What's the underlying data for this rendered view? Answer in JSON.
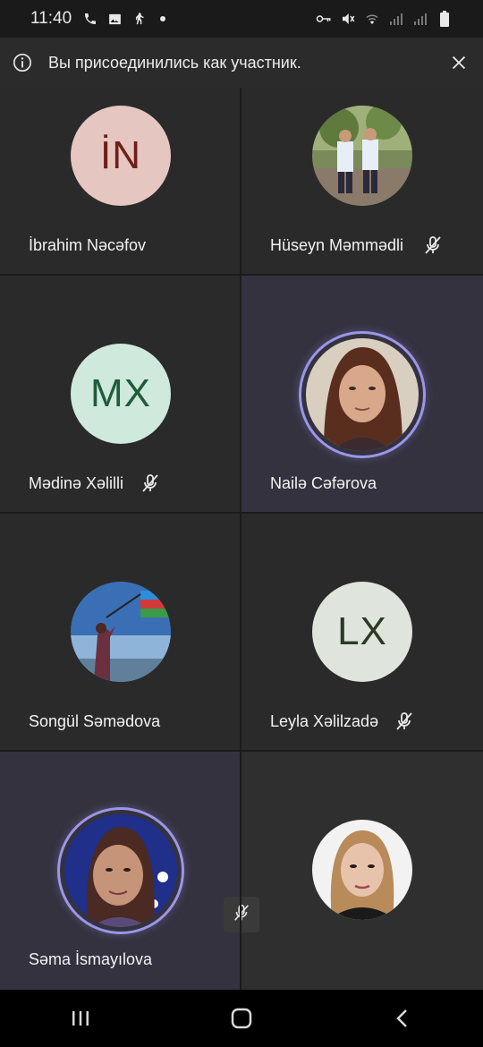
{
  "status_bar": {
    "time": "11:40",
    "left_icons": [
      "phone-icon",
      "image-icon",
      "walking-icon",
      "dot-icon"
    ],
    "right_icons": [
      "key-icon",
      "mute-icon",
      "wifi-icon",
      "signal-icon",
      "signal-icon",
      "battery-icon"
    ]
  },
  "banner": {
    "message": "Вы присоединились как участник.",
    "icon": "info-icon",
    "close_icon": "close-icon"
  },
  "participants": [
    {
      "name": "İbrahim Nəcəfov",
      "initials": "İN",
      "avatar_bg": "#e6c6c0",
      "initials_color": "#6e1f1a",
      "muted": false,
      "speaking": false,
      "photo": false
    },
    {
      "name": "Hüseyn Məmmədli",
      "initials": "",
      "muted": true,
      "speaking": false,
      "photo": true
    },
    {
      "name": "Mədinə Xəlilli",
      "initials": "MX",
      "avatar_bg": "#cfe9dc",
      "initials_color": "#1f5c3a",
      "muted": true,
      "speaking": false,
      "photo": false
    },
    {
      "name": "Nailə Cəfərova",
      "initials": "",
      "muted": false,
      "speaking": true,
      "photo": true
    },
    {
      "name": "Songül Səmədova",
      "initials": "",
      "muted": false,
      "speaking": false,
      "photo": true
    },
    {
      "name": "Leyla Xəlilzadə",
      "initials": "LX",
      "avatar_bg": "#dfe5dc",
      "initials_color": "#2b3a25",
      "muted": true,
      "speaking": false,
      "photo": false
    },
    {
      "name": "Səma İsmayılova",
      "initials": "",
      "muted": true,
      "speaking": true,
      "photo": true
    },
    {
      "name": "",
      "initials": "",
      "muted": false,
      "speaking": false,
      "photo": true
    }
  ],
  "colors": {
    "speaking_ring": "#9b96e8",
    "tile_bg": "#2d2d2d",
    "highlight_bg": "#34323f"
  },
  "nav": [
    "recent-apps-icon",
    "home-icon",
    "back-icon"
  ]
}
